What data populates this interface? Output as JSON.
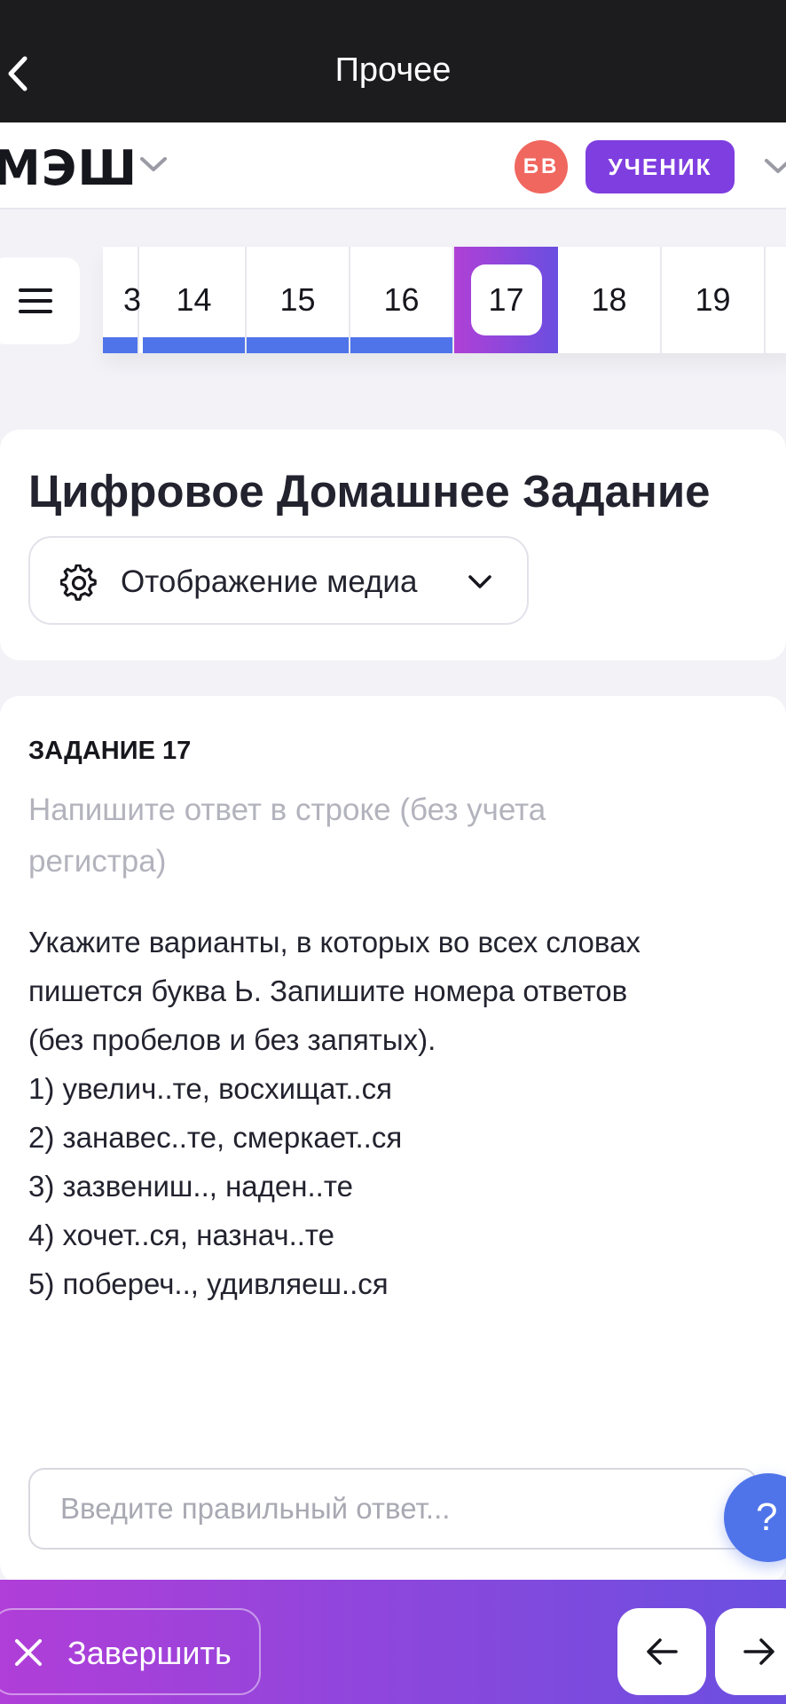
{
  "topbar": {
    "title": "Прочее"
  },
  "header": {
    "logo": "МЭШ",
    "avatar_initials": "БВ",
    "role": "УЧЕНИК"
  },
  "task_nav": {
    "partial_label": "3",
    "tasks": [
      {
        "label": "14",
        "state": "done"
      },
      {
        "label": "15",
        "state": "done"
      },
      {
        "label": "16",
        "state": "done"
      },
      {
        "label": "17",
        "state": "current"
      },
      {
        "label": "18",
        "state": "todo"
      },
      {
        "label": "19",
        "state": "todo"
      }
    ]
  },
  "page": {
    "title": "Цифровое Домашнее Задание",
    "media_select_label": "Отображение медиа"
  },
  "task": {
    "number": "ЗАДАНИЕ 17",
    "hint": "Напишите ответ в строке (без учета регистра)",
    "text_lines": [
      "Укажите варианты, в которых во всех словах",
      "пишется буква Ь. Запишите номера ответов",
      "(без пробелов и без запятых).",
      "1) увелич..те, восхищат..ся",
      "2) занавес..те, смеркает..ся",
      "3) зазвениш.., наден..те",
      "4) хочет..ся, назнач..те",
      "5) побереч.., удивляеш..ся"
    ],
    "answer_placeholder": "Введите правильный ответ...",
    "answer_value": ""
  },
  "help": {
    "label": "?"
  },
  "bottombar": {
    "finish_label": "Завершить",
    "prev_icon": "arrow-left-icon",
    "next_icon": "arrow-right-icon"
  },
  "colors": {
    "accent_purple": "#7f3ee0",
    "accent_blue": "#4f74ea",
    "avatar_red": "#f0675f",
    "gradient_start": "#b03ed8",
    "gradient_end": "#6a4fe0"
  }
}
